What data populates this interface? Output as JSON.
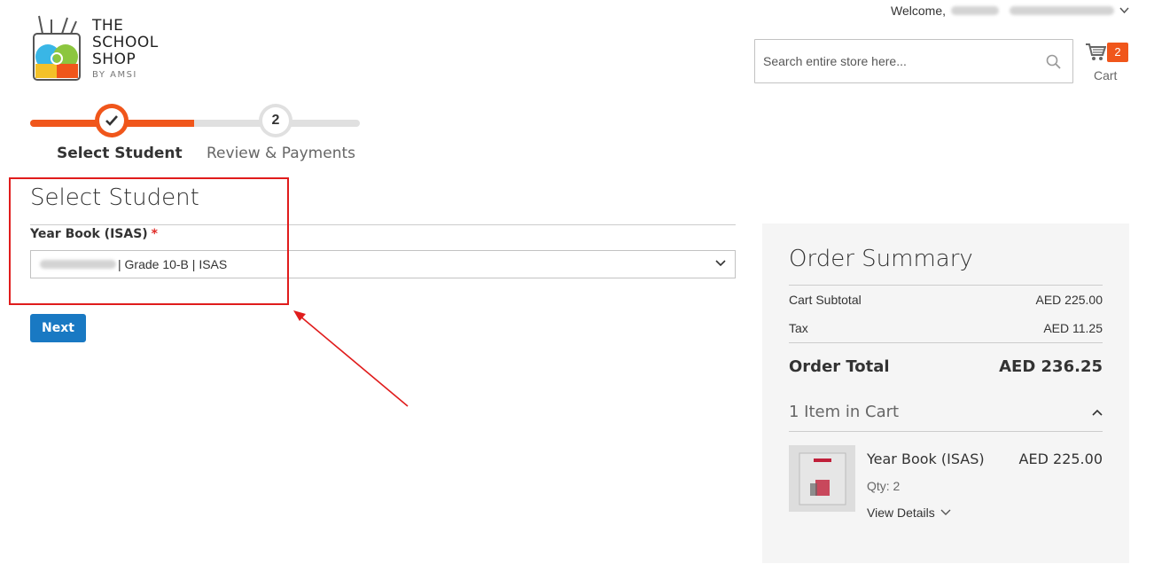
{
  "brand": {
    "logo_line1": "THE",
    "logo_line2": "SCHOOL",
    "logo_line3": "SHOP",
    "logo_sub": "BY AMSI"
  },
  "header": {
    "welcome_label": "Welcome,",
    "search_placeholder": "Search entire store here...",
    "cart_label": "Cart",
    "cart_count": "2"
  },
  "progress": {
    "step1_label": "Select Student",
    "step2_number": "2",
    "step2_label": "Review & Payments"
  },
  "form": {
    "title": "Select Student",
    "field_label": "Year Book (ISAS)",
    "required_mark": "*",
    "selected_value": "| Grade 10-B | ISAS",
    "next_label": "Next"
  },
  "summary": {
    "title": "Order Summary",
    "subtotal_label": "Cart Subtotal",
    "subtotal_value": "AED 225.00",
    "tax_label": "Tax",
    "tax_value": "AED 11.25",
    "total_label": "Order Total",
    "total_value": "AED 236.25",
    "items_count_label": "1 Item in Cart",
    "item": {
      "name": "Year Book (ISAS)",
      "price": "AED 225.00",
      "qty": "Qty: 2",
      "details_label": "View Details"
    }
  },
  "colors": {
    "accent": "#f0561b",
    "primary_button": "#1979c3",
    "annotation": "#e01c1c"
  }
}
